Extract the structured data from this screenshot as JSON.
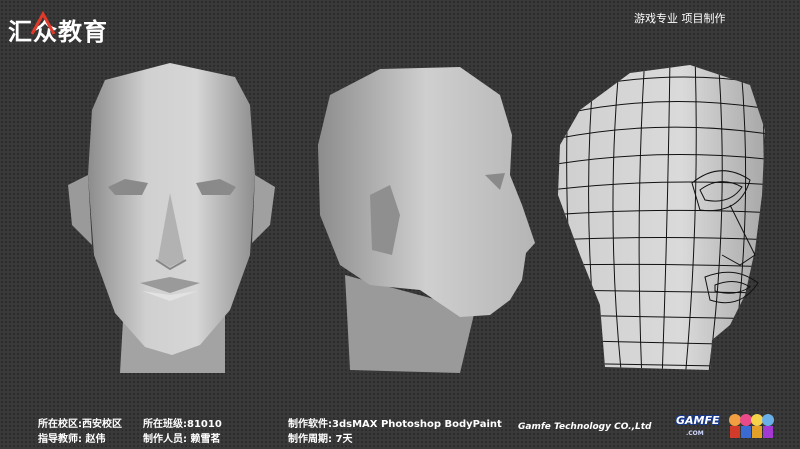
{
  "header": {
    "logo_text": "汇众教育",
    "slogan": "游戏专业  项目制作"
  },
  "info": {
    "campus": "所在校区:西安校区",
    "class": "所在班级:81010",
    "software": "制作软件:3dsMAX Photoshop BodyPaint",
    "teacher": "指导教师: 赵伟",
    "staff": "制作人员: 赖雪茗",
    "period": "制作周期: 7天"
  },
  "footer": {
    "company": "Gamfe  Technology CO.,Ltd",
    "brand_text": "GAMFE",
    "brand_sub": ".COM"
  },
  "colors": {
    "background": "#3a3a3a",
    "model": "#c4c4c4",
    "wire": "#111111",
    "logo_red": "#e23a2a"
  }
}
